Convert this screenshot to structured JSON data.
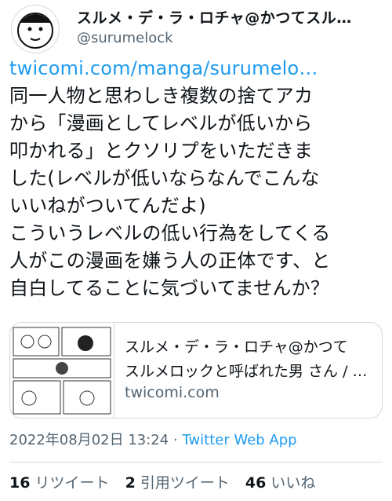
{
  "user": {
    "display_name": "スルメ・デ・ラ・ロチャ@かつてスル…",
    "handle": "@surumelock"
  },
  "tweet": {
    "link": "twicomi.com/manga/surumelo…",
    "lines": [
      "同一人物と思わしき複数の捨てアカ",
      "から「漫画としてレベルが低いから",
      "叩かれる」とクソリプをいただきま",
      "した(レベルが低いならなんでこんな",
      "いいねがついてんだよ)",
      "こういうレベルの低い行為をしてくる",
      "人がこの漫画を嫌う人の正体です、と",
      "自白してることに気づいてませんか？"
    ]
  },
  "card": {
    "title_line1": "スルメ・デ・ラ・ロチャ@かつて",
    "title_line2": "スルメロックと呼ばれた男 さん / …",
    "domain": "twicomi.com"
  },
  "meta": {
    "datetime": "2022年08月02日 13:24",
    "separator": "·",
    "source": "Twitter Web App"
  },
  "stats": {
    "retweets": "16",
    "retweets_label": "リツイート",
    "quotes": "2",
    "quotes_label": "引用ツイート",
    "likes": "46",
    "likes_label": "いいね"
  }
}
